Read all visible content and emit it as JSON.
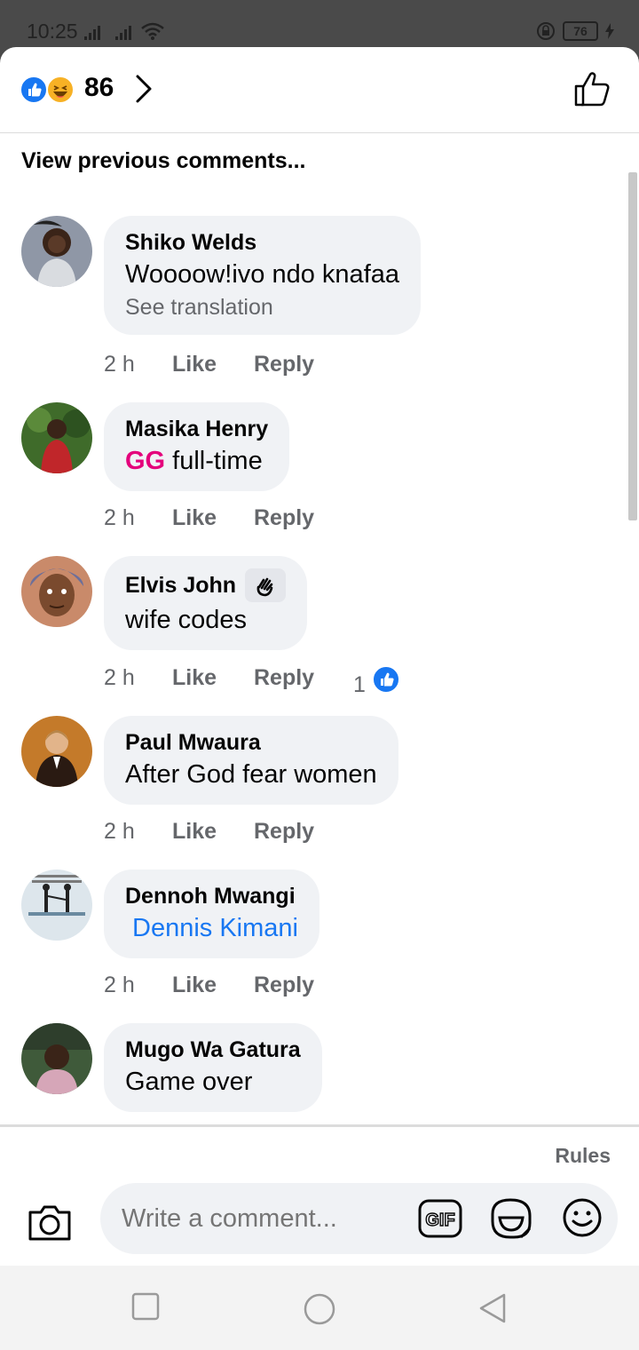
{
  "status_bar": {
    "time": "10:25",
    "battery": "76"
  },
  "header": {
    "reaction_count": "86",
    "reactions": [
      "like-icon",
      "haha-icon"
    ]
  },
  "view_previous": "View previous comments...",
  "comments": [
    {
      "author": "Shiko Welds",
      "text": "Woooow!ivo ndo knafaa",
      "see_translation": "See translation",
      "time": "2 h",
      "like": "Like",
      "reply": "Reply"
    },
    {
      "author": "Masika Henry",
      "tag": "GG",
      "text": " full-time",
      "time": "2 h",
      "like": "Like",
      "reply": "Reply"
    },
    {
      "author": "Elvis John",
      "badge_icon": "wave-hand-icon",
      "text": "wife codes",
      "time": "2 h",
      "like": "Like",
      "reply": "Reply",
      "like_count": "1"
    },
    {
      "author": "Paul Mwaura",
      "text": "After God fear women",
      "time": "2 h",
      "like": "Like",
      "reply": "Reply"
    },
    {
      "author": "Dennoh Mwangi",
      "mention": "Dennis Kimani",
      "time": "2 h",
      "like": "Like",
      "reply": "Reply"
    },
    {
      "author": "Mugo Wa Gatura",
      "text": "Game over"
    }
  ],
  "composer": {
    "rules": "Rules",
    "placeholder": "Write a comment..."
  },
  "colors": {
    "facebook_blue": "#1877f2",
    "bubble_bg": "#f0f2f5",
    "secondary_text": "#65676b",
    "tag_pink": "#e4007c"
  }
}
